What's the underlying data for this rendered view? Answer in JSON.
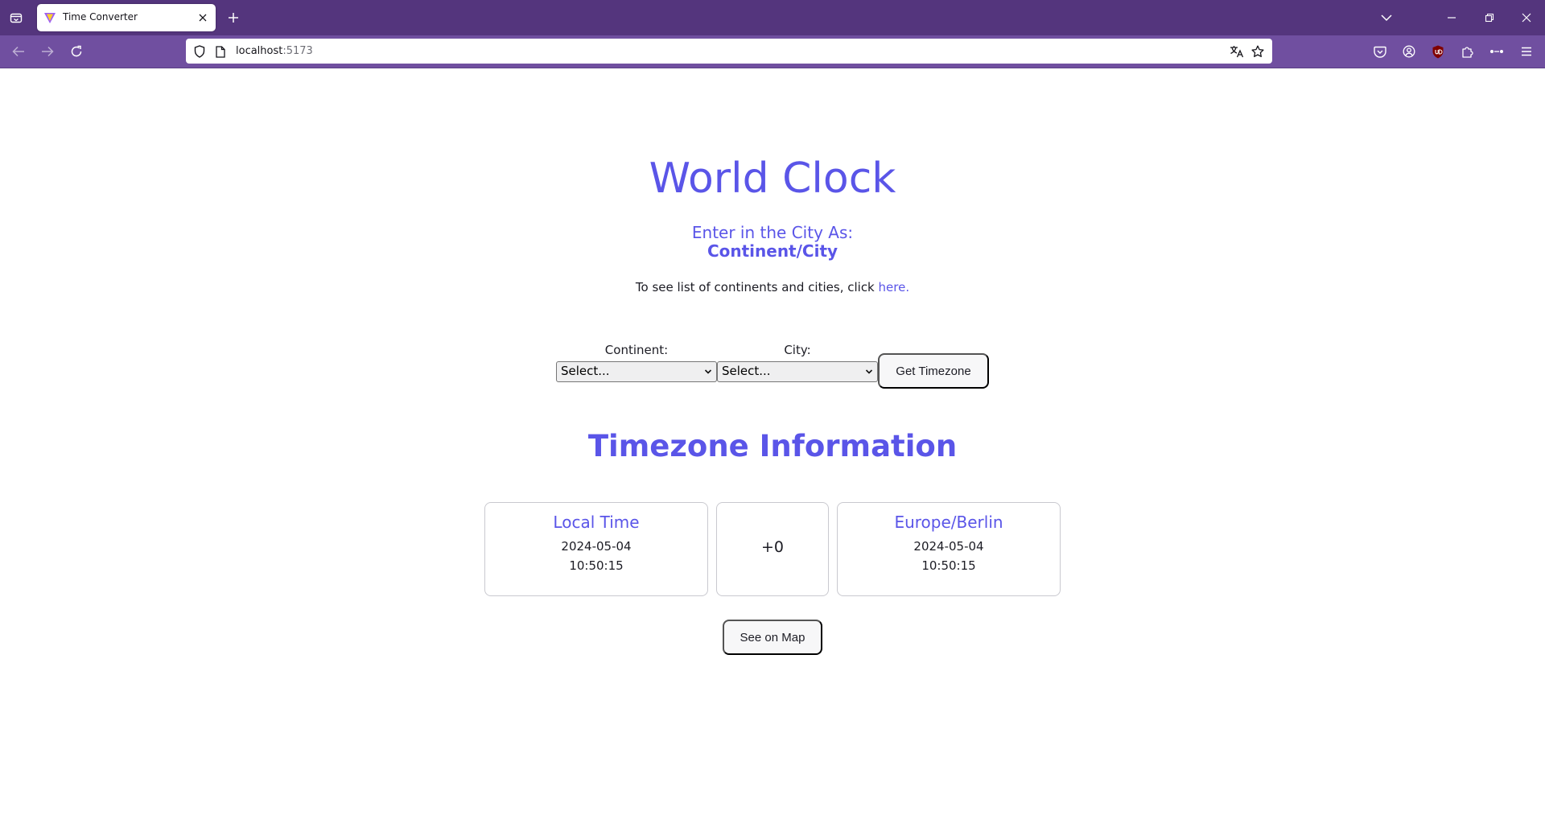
{
  "browser": {
    "tab": {
      "title": "Time Converter"
    },
    "url": {
      "host": "localhost",
      "port": ":5173"
    },
    "icons": {
      "tab_list": "tab-list-icon",
      "new_tab": "plus-icon",
      "all_tabs": "chevron-down-icon",
      "minimize": "minimize-icon",
      "restore": "restore-icon",
      "close_window": "close-icon",
      "back": "back-arrow-icon",
      "forward": "forward-arrow-icon",
      "reload": "reload-icon",
      "tracking": "shield-icon",
      "page": "page-icon",
      "translate": "translate-icon",
      "bookmark": "star-icon",
      "pocket": "pocket-icon",
      "account": "account-icon",
      "ublock": "ublock-icon",
      "extensions": "puzzle-icon",
      "overflow": "overflow-icon",
      "menu": "hamburger-menu-icon"
    },
    "colors": {
      "tabbar": "#54357d",
      "navbar": "#704fa0",
      "accent": "#5a55e8"
    }
  },
  "app": {
    "title": "World Clock",
    "instruction_line1": "Enter in the City As:",
    "instruction_line2": "Continent/City",
    "hint_text": "To see list of continents and cities, click ",
    "hint_link": "here.",
    "form": {
      "continent_label": "Continent:",
      "continent_value": "Select...",
      "city_label": "City:",
      "city_value": "Select...",
      "submit_label": "Get Timezone"
    },
    "timezone_info": {
      "title": "Timezone Information",
      "local": {
        "heading": "Local Time",
        "date": "2024-05-04",
        "time": "10:50:15"
      },
      "offset": "+0",
      "remote": {
        "heading": "Europe/Berlin",
        "date": "2024-05-04",
        "time": "10:50:15"
      }
    },
    "map_button_label": "See on Map"
  }
}
